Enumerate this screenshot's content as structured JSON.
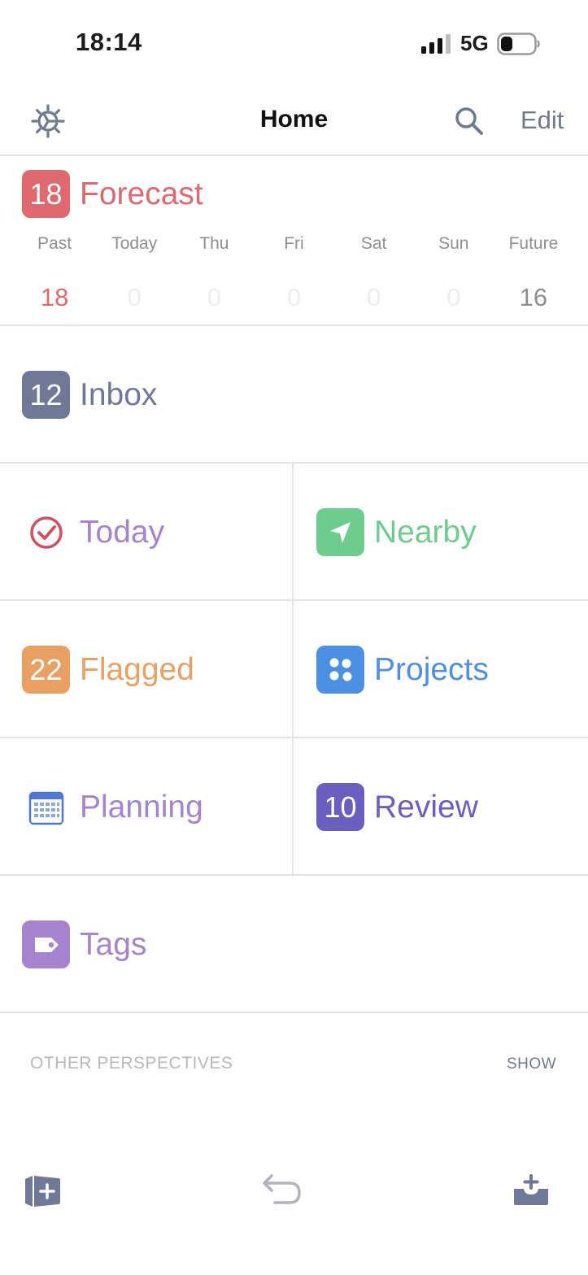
{
  "status_bar": {
    "time": "18:14",
    "network": "5G"
  },
  "nav": {
    "title": "Home",
    "edit_label": "Edit"
  },
  "forecast": {
    "badge": "18",
    "label": "Forecast",
    "color": "#e0686f",
    "days": [
      {
        "name": "Past",
        "count": "18"
      },
      {
        "name": "Today",
        "count": "0"
      },
      {
        "name": "Thu",
        "count": "0"
      },
      {
        "name": "Fri",
        "count": "0"
      },
      {
        "name": "Sat",
        "count": "0"
      },
      {
        "name": "Sun",
        "count": "0"
      },
      {
        "name": "Future",
        "count": "16"
      }
    ]
  },
  "inbox": {
    "badge": "12",
    "label": "Inbox",
    "color": "#6f7896"
  },
  "today": {
    "label": "Today",
    "icon": "checkmark-circle-icon",
    "color": "#a583cf"
  },
  "nearby": {
    "label": "Nearby",
    "icon": "location-arrow-icon",
    "color": "#6dcc8e"
  },
  "flagged": {
    "badge": "22",
    "label": "Flagged",
    "color": "#e9a063"
  },
  "projects": {
    "label": "Projects",
    "icon": "projects-icon",
    "color": "#4d90e3"
  },
  "planning": {
    "label": "Planning",
    "icon": "calendar-icon",
    "color": "#a583cf"
  },
  "review": {
    "badge": "10",
    "label": "Review",
    "color": "#6a5fbf"
  },
  "tags": {
    "label": "Tags",
    "icon": "tag-icon",
    "color": "#a583cf"
  },
  "other_perspectives": {
    "label": "OTHER PERSPECTIVES",
    "show_label": "SHOW"
  },
  "toolbar": {
    "icons": [
      "sidebar-add-icon",
      "undo-icon",
      "inbox-add-icon"
    ]
  }
}
